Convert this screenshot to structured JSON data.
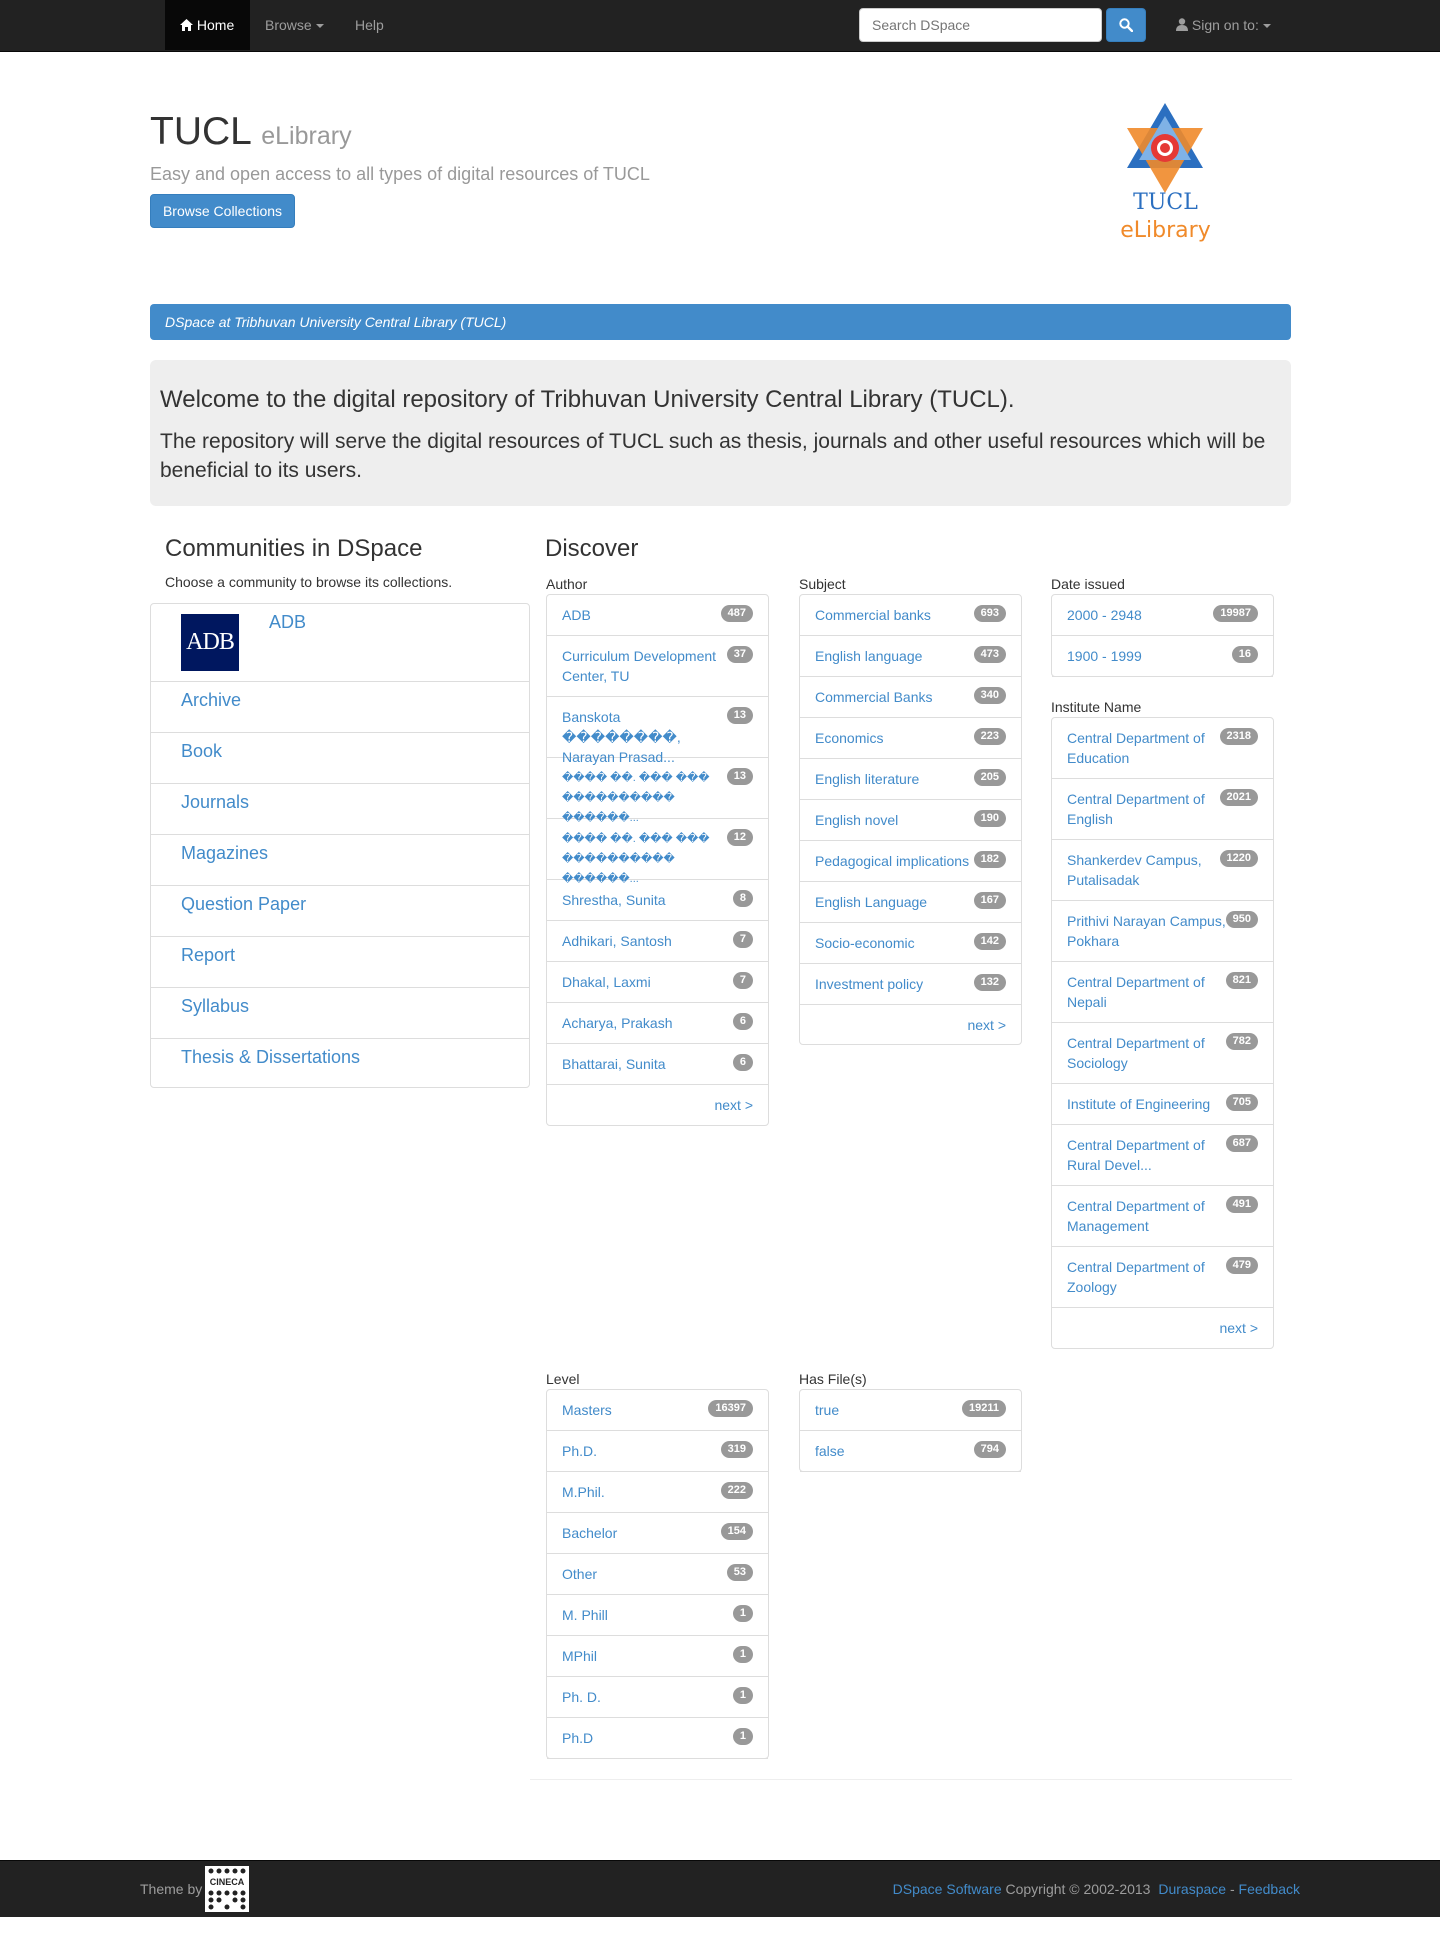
{
  "navbar": {
    "home": "Home",
    "browse": "Browse",
    "help": "Help",
    "search_placeholder": "Search DSpace",
    "sign_on": "Sign on to:"
  },
  "jumbotron": {
    "title": "TUCL",
    "title_small": "eLibrary",
    "subtitle": "Easy and open access to all types of digital resources of TUCL",
    "browse_button": "Browse Collections",
    "logo_text_1": "TUCL",
    "logo_text_2": "eLibrary"
  },
  "breadcrumb": "DSpace at Tribhuvan University Central Library (TUCL)",
  "welcome": {
    "heading": "Welcome to the digital repository of Tribhuvan University Central Library (TUCL).",
    "text": "The repository will serve the digital resources of TUCL such as thesis, journals and other useful resources which will be beneficial to its users."
  },
  "communities": {
    "title": "Communities in DSpace",
    "subtitle": "Choose a community to browse its collections.",
    "adb_logo_text": "ADB",
    "items": [
      "ADB",
      "Archive",
      "Book",
      "Journals",
      "Magazines",
      "Question Paper",
      "Report",
      "Syllabus",
      "Thesis & Dissertations"
    ]
  },
  "discover": {
    "title": "Discover",
    "next_label": "next >",
    "author": {
      "label": "Author",
      "items": [
        {
          "name": "ADB",
          "count": "487"
        },
        {
          "name": "Curriculum Development Center, TU",
          "count": "37"
        },
        {
          "name": "Banskota ��������, Narayan Prasad...",
          "count": "13"
        },
        {
          "name": "���� ��. ��� ��� ���������� ������...",
          "count": "13"
        },
        {
          "name": "���� ��. ��� ��� ���������� ������...",
          "count": "12"
        },
        {
          "name": "Shrestha, Sunita",
          "count": "8"
        },
        {
          "name": "Adhikari, Santosh",
          "count": "7"
        },
        {
          "name": "Dhakal, Laxmi",
          "count": "7"
        },
        {
          "name": "Acharya, Prakash",
          "count": "6"
        },
        {
          "name": "Bhattarai, Sunita",
          "count": "6"
        }
      ]
    },
    "subject": {
      "label": "Subject",
      "items": [
        {
          "name": "Commercial banks",
          "count": "693"
        },
        {
          "name": "English language",
          "count": "473"
        },
        {
          "name": "Commercial Banks",
          "count": "340"
        },
        {
          "name": "Economics",
          "count": "223"
        },
        {
          "name": "English literature",
          "count": "205"
        },
        {
          "name": "English novel",
          "count": "190"
        },
        {
          "name": "Pedagogical implications",
          "count": "182"
        },
        {
          "name": "English Language",
          "count": "167"
        },
        {
          "name": "Socio-economic",
          "count": "142"
        },
        {
          "name": "Investment policy",
          "count": "132"
        }
      ]
    },
    "date_issued": {
      "label": "Date issued",
      "items": [
        {
          "name": "2000 - 2948",
          "count": "19987"
        },
        {
          "name": "1900 - 1999",
          "count": "16"
        }
      ]
    },
    "institute": {
      "label": "Institute Name",
      "items": [
        {
          "name": "Central Department of Education",
          "count": "2318"
        },
        {
          "name": "Central Department of English",
          "count": "2021"
        },
        {
          "name": "Shankerdev Campus, Putalisadak",
          "count": "1220"
        },
        {
          "name": "Prithivi Narayan Campus, Pokhara",
          "count": "950"
        },
        {
          "name": "Central Department of Nepali",
          "count": "821"
        },
        {
          "name": "Central Department of Sociology",
          "count": "782"
        },
        {
          "name": "Institute of Engineering",
          "count": "705"
        },
        {
          "name": "Central Department of Rural Devel...",
          "count": "687"
        },
        {
          "name": "Central Department of Management",
          "count": "491"
        },
        {
          "name": "Central Department of Zoology",
          "count": "479"
        }
      ]
    },
    "level": {
      "label": "Level",
      "items": [
        {
          "name": "Masters",
          "count": "16397"
        },
        {
          "name": "Ph.D.",
          "count": "319"
        },
        {
          "name": "M.Phil.",
          "count": "222"
        },
        {
          "name": "Bachelor",
          "count": "154"
        },
        {
          "name": "Other",
          "count": "53"
        },
        {
          "name": "M. Phill",
          "count": "1"
        },
        {
          "name": "MPhil",
          "count": "1"
        },
        {
          "name": "Ph. D.",
          "count": "1"
        },
        {
          "name": "Ph.D",
          "count": "1"
        }
      ]
    },
    "has_files": {
      "label": "Has File(s)",
      "items": [
        {
          "name": "true",
          "count": "19211"
        },
        {
          "name": "false",
          "count": "794"
        }
      ]
    }
  },
  "footer": {
    "theme_by": "Theme by",
    "cineca_text": "CINECA",
    "dspace_software": "DSpace Software",
    "copyright": "Copyright © 2002-2013",
    "duraspace": "Duraspace",
    "separator": "-",
    "feedback": "Feedback"
  }
}
